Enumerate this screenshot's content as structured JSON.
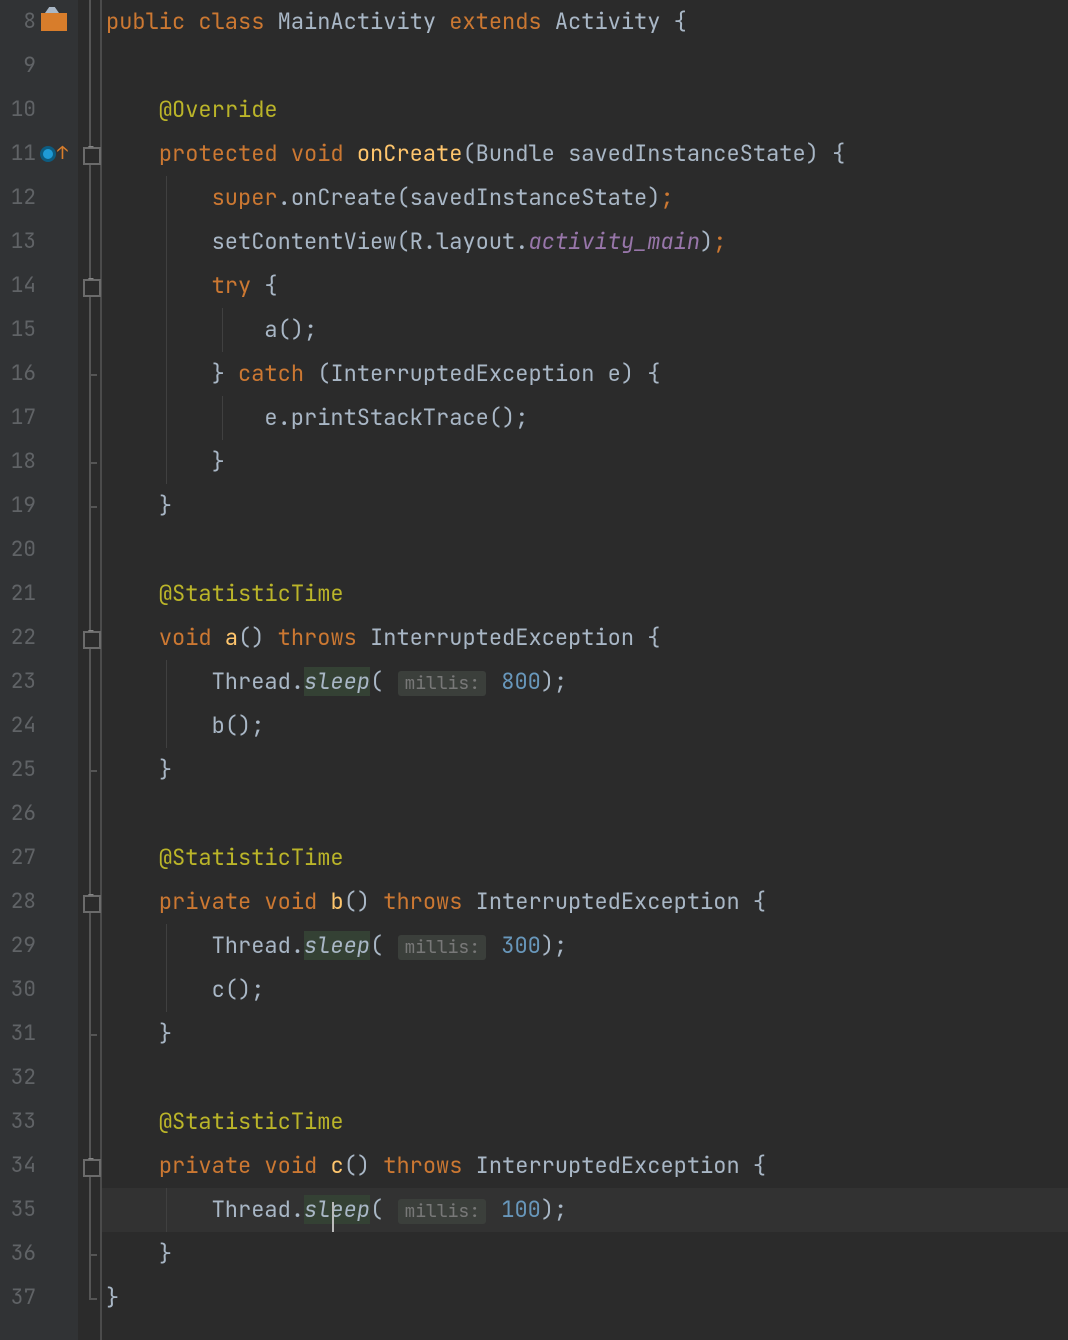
{
  "lines": {
    "start": 8,
    "end": 37,
    "cursor_line": 35,
    "override_line": 11,
    "class_icon_line": 8
  },
  "tokens": {
    "public": "public",
    "class": "class",
    "MainActivity": "MainActivity",
    "extends": "extends",
    "Activity": "Activity",
    "lbrace": "{",
    "rbrace": "}",
    "Override": "@Override",
    "protected": "protected",
    "void": "void",
    "onCreate": "onCreate",
    "Bundle": "Bundle",
    "savedInstanceState": "savedInstanceState",
    "super": "super",
    "setContentView": "setContentView",
    "R": "R",
    "layout": "layout",
    "activity_main": "activity_main",
    "try": "try",
    "a_call": "a();",
    "catch": "catch",
    "InterruptedException": "InterruptedException",
    "e_var": "e",
    "printStackTrace": "e.printStackTrace();",
    "StatisticTime": "@StatisticTime",
    "a_name": "a",
    "throws": "throws",
    "Thread": "Thread",
    "sleep": "sleep",
    "millis_hint": "millis:",
    "val_800": "800",
    "b_call": "b();",
    "private": "private",
    "b_name": "b",
    "val_300": "300",
    "c_call": "c();",
    "c_name": "c",
    "val_100": "100",
    "rparen_semi": ");",
    "lparen": "(",
    "rparen": ")",
    "dot": ".",
    "semi": ";",
    "paren_empty": "()"
  }
}
